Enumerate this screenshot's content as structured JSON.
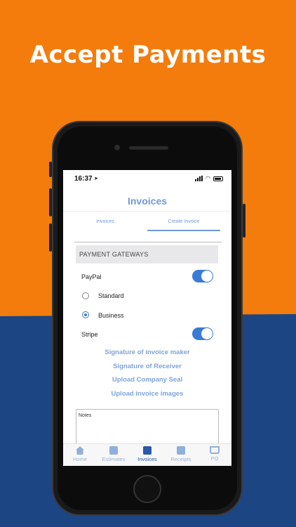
{
  "headline": "Accept Payments",
  "colors": {
    "orange": "#f47c0c",
    "navy": "#1c4584",
    "accent": "#3a7bd5",
    "link": "#7ea4dc"
  },
  "status_bar": {
    "time": "16:37"
  },
  "app": {
    "title": "Invoices",
    "tabs": [
      {
        "label": "Invoices",
        "active": false
      },
      {
        "label": "Create Invoice",
        "active": true
      }
    ],
    "payment_section": {
      "header": "PAYMENT GATEWAYS",
      "paypal": {
        "label": "PayPal",
        "enabled": true
      },
      "options": [
        {
          "label": "Standard",
          "selected": false
        },
        {
          "label": "Business",
          "selected": true
        }
      ],
      "stripe": {
        "label": "Stripe",
        "enabled": true
      }
    },
    "links": [
      "Signature of invoice maker",
      "Signature of Receiver",
      "Upload Company Seal",
      "Upload invoice images"
    ],
    "notes_placeholder": "Notes"
  },
  "tabbar": [
    {
      "label": "Home",
      "icon": "home-icon",
      "active": false
    },
    {
      "label": "Estimates",
      "icon": "estimates-icon",
      "active": false
    },
    {
      "label": "Invoices",
      "icon": "invoices-icon",
      "active": true
    },
    {
      "label": "Receipts",
      "icon": "receipts-icon",
      "active": false
    },
    {
      "label": "PO",
      "icon": "cart-icon",
      "active": false
    }
  ]
}
